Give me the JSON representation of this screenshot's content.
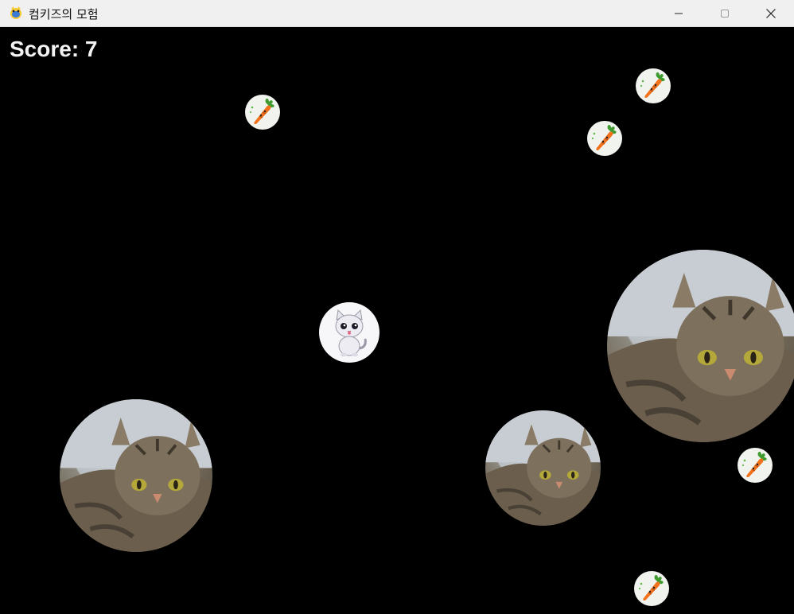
{
  "window": {
    "title": "컴키즈의 모험",
    "app_icon": "pygame-snake-icon",
    "controls": [
      "minimize-icon",
      "maximize-icon",
      "close-icon"
    ]
  },
  "hud": {
    "score_text": "Score: 7"
  },
  "sprites": {
    "player": "white-kitten-icon",
    "collectible": "carrot-icon",
    "enemy": "tabby-cat-photo"
  },
  "counts": {
    "carrots": 5,
    "enemy_cats": 3
  },
  "colors": {
    "background": "#000000",
    "titlebar": "#f0f0f0",
    "score": "#f2f2f2",
    "carrot_orange": "#f2711c",
    "carrot_leaf": "#3f9b2f"
  }
}
